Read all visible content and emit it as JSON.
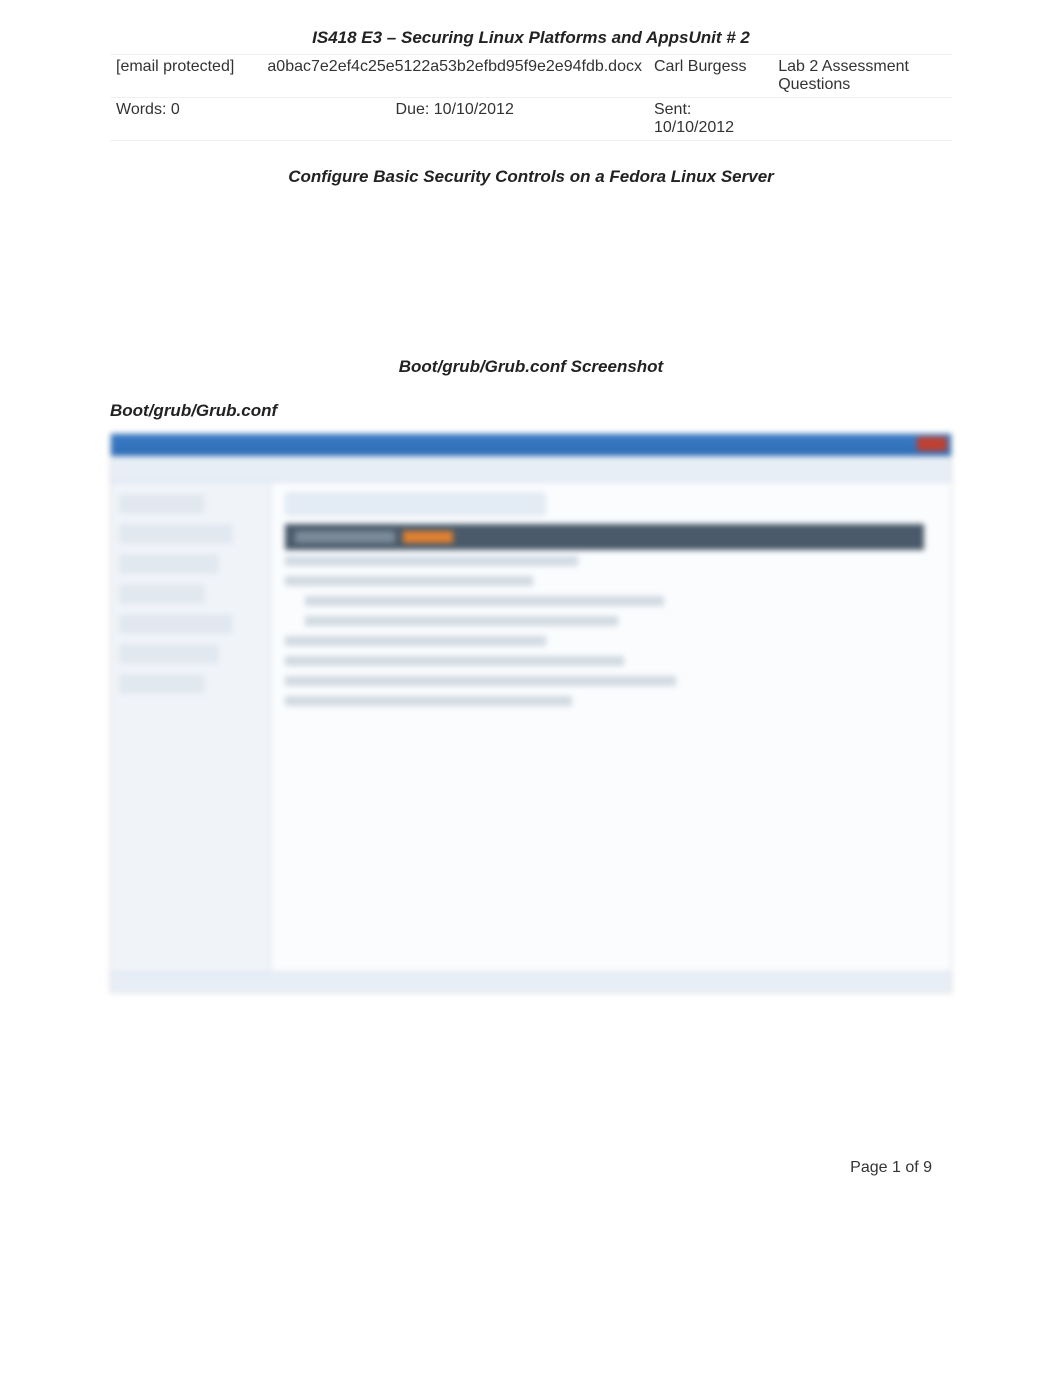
{
  "header": {
    "course_title": "IS418 E3 – Securing Linux Platforms and AppsUnit # 2"
  },
  "meta": {
    "row1": {
      "email": "[email protected]",
      "filename": "a0bac7e2ef4c25e5122a53b2efbd95f9e2e94fdb.docx",
      "author": "Carl Burgess",
      "topic": "Lab 2 Assessment Questions"
    },
    "row2": {
      "words": "Words: 0",
      "due": "Due: 10/10/2012",
      "sent": "Sent: 10/10/2012",
      "blank": ""
    }
  },
  "sections": {
    "main_title": "Configure Basic Security Controls on a Fedora Linux Server",
    "screenshot_title": "Boot/grub/Grub.conf Screenshot",
    "screenshot_label": "Boot/grub/Grub.conf"
  },
  "footer": {
    "page_info": "Page 1 of 9"
  }
}
